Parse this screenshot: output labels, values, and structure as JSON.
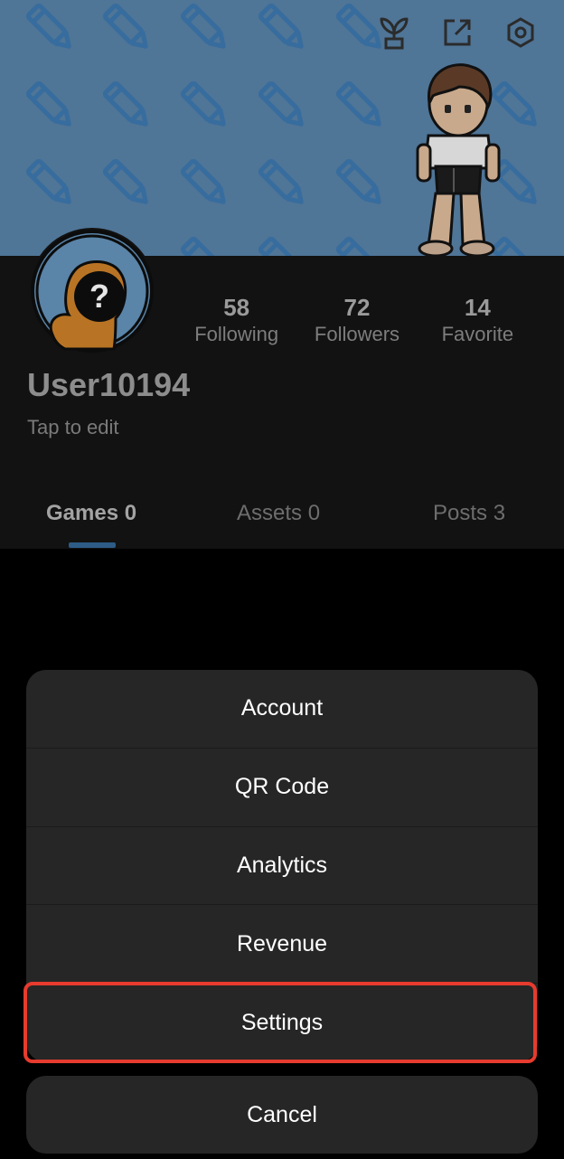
{
  "header": {
    "icons": [
      "sprout-icon",
      "share-icon",
      "settings-icon"
    ]
  },
  "profile": {
    "username": "User10194",
    "subtitle": "Tap to edit",
    "stats": [
      {
        "value": "58",
        "label": "Following"
      },
      {
        "value": "72",
        "label": "Followers"
      },
      {
        "value": "14",
        "label": "Favorite"
      }
    ]
  },
  "tabs": [
    {
      "label": "Games 0",
      "active": true
    },
    {
      "label": "Assets 0",
      "active": false
    },
    {
      "label": "Posts 3",
      "active": false
    }
  ],
  "menu": {
    "items": [
      "Account",
      "QR Code",
      "Analytics",
      "Revenue",
      "Settings"
    ],
    "highlighted": "Settings",
    "cancel_label": "Cancel"
  },
  "colors": {
    "banner": "#4f7597",
    "highlight": "#e63b2e",
    "tab_indicator": "#2d5c86",
    "sheet": "#262626"
  }
}
